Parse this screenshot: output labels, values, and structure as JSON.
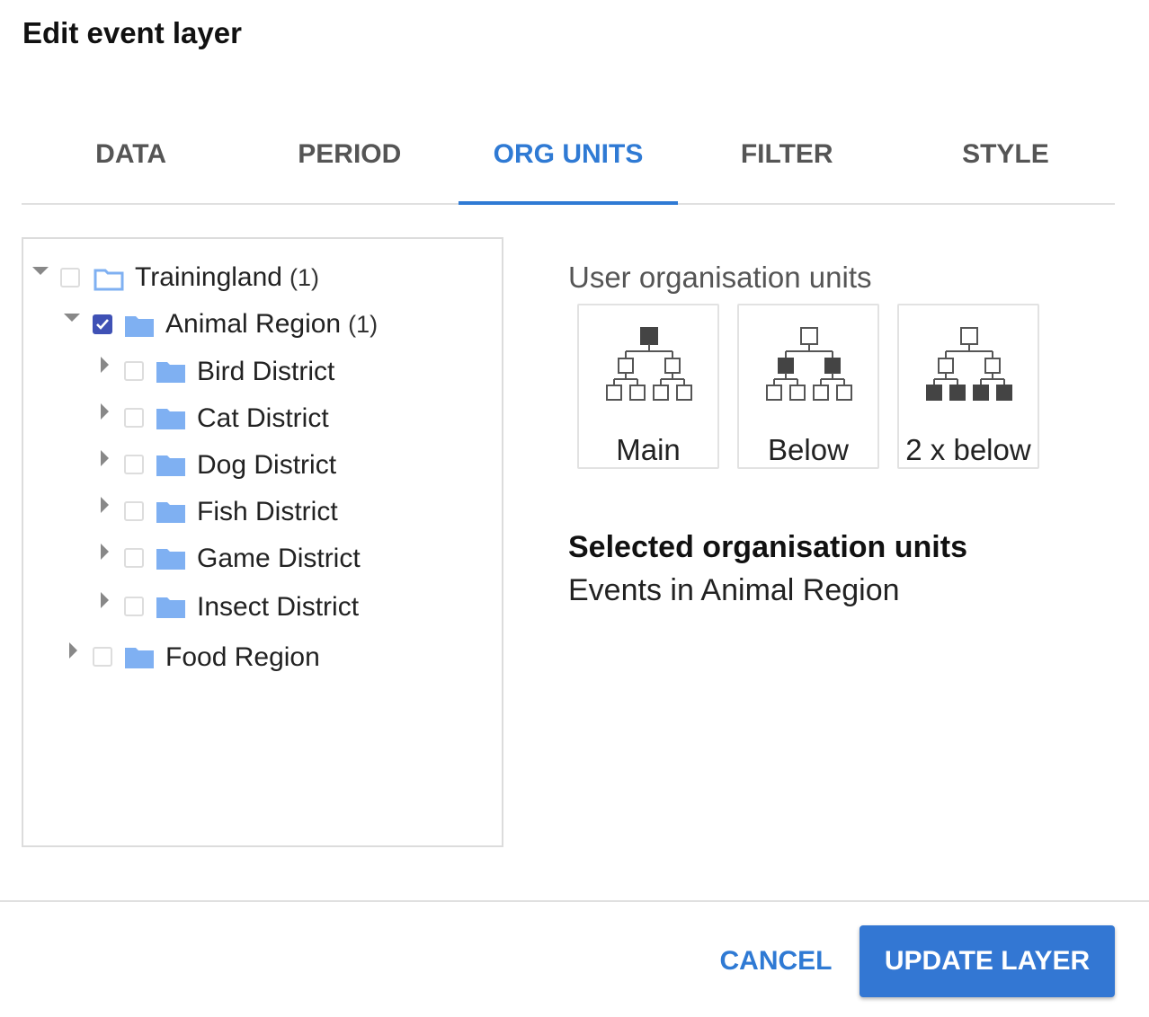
{
  "dialog": {
    "title": "Edit event layer"
  },
  "tabs": [
    {
      "label": "DATA"
    },
    {
      "label": "PERIOD"
    },
    {
      "label": "ORG UNITS"
    },
    {
      "label": "FILTER"
    },
    {
      "label": "STYLE"
    }
  ],
  "active_tab": "ORG UNITS",
  "tree": {
    "root": {
      "label": "Trainingland",
      "count": "(1)",
      "expanded": true,
      "checked": false
    },
    "region1": {
      "label": "Animal Region",
      "count": "(1)",
      "expanded": true,
      "checked": true
    },
    "districts": [
      {
        "label": "Bird District"
      },
      {
        "label": "Cat District"
      },
      {
        "label": "Dog District"
      },
      {
        "label": "Fish District"
      },
      {
        "label": "Game District"
      },
      {
        "label": "Insect District"
      }
    ],
    "region2": {
      "label": "Food Region",
      "expanded": false,
      "checked": false
    }
  },
  "user_org_units": {
    "title": "User organisation units",
    "levels": [
      {
        "label": "Main",
        "icon": "org-level-main-icon"
      },
      {
        "label": "Below",
        "icon": "org-level-below-icon"
      },
      {
        "label": "2 x below",
        "icon": "org-level-two-below-icon"
      }
    ]
  },
  "selected": {
    "title": "Selected organisation units",
    "value": "Events in Animal Region"
  },
  "footer": {
    "cancel_label": "CANCEL",
    "update_label": "UPDATE LAYER"
  },
  "colors": {
    "accent": "#2f7ad4",
    "primary_button": "#3377d3",
    "checkbox_checked": "#3f51b5",
    "folder": "#7fb0f2"
  }
}
